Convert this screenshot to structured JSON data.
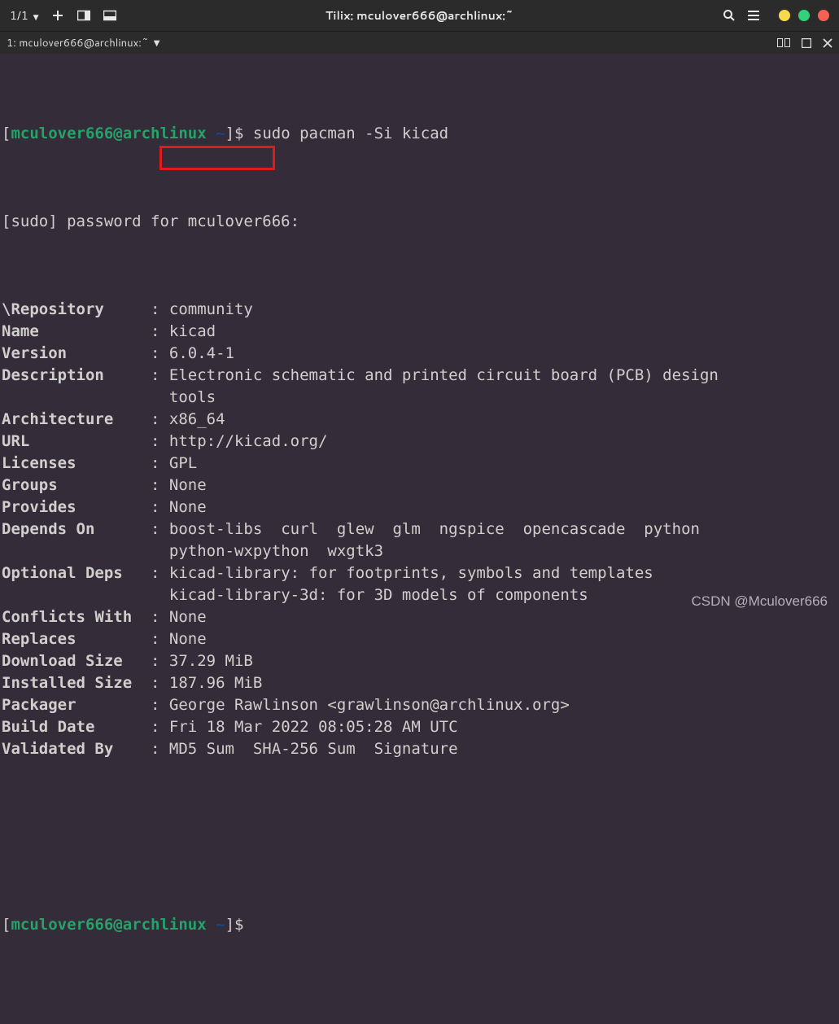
{
  "titlebar": {
    "pane_label": "1/1",
    "title": "Tilix: mculover666@archlinux:~"
  },
  "tabbar": {
    "tab_label": "1: mculover666@archlinux:~"
  },
  "traffic_colors": {
    "min": "#f7d94c",
    "max": "#33d17a",
    "close": "#f66151"
  },
  "prompt": {
    "open": "[",
    "user": "mculover666@archlinux",
    "space": " ",
    "tilde": "~",
    "close": "]$ ",
    "command": "sudo pacman -Si kicad"
  },
  "sudo_line": "[sudo] password for mculover666:",
  "fields": [
    {
      "label": "\\Repository     ",
      "value": "community"
    },
    {
      "label": "Name            ",
      "value": "kicad"
    },
    {
      "label": "Version         ",
      "value": "6.0.4-1"
    },
    {
      "label": "Description     ",
      "value": "Electronic schematic and printed circuit board (PCB) design"
    },
    {
      "label": "                ",
      "value": "tools",
      "cont": true
    },
    {
      "label": "Architecture    ",
      "value": "x86_64"
    },
    {
      "label": "URL             ",
      "value": "http://kicad.org/"
    },
    {
      "label": "Licenses        ",
      "value": "GPL"
    },
    {
      "label": "Groups          ",
      "value": "None"
    },
    {
      "label": "Provides        ",
      "value": "None"
    },
    {
      "label": "Depends On      ",
      "value": "boost-libs  curl  glew  glm  ngspice  opencascade  python"
    },
    {
      "label": "                ",
      "value": "python-wxpython  wxgtk3",
      "cont": true
    },
    {
      "label": "Optional Deps   ",
      "value": "kicad-library: for footprints, symbols and templates"
    },
    {
      "label": "                ",
      "value": "kicad-library-3d: for 3D models of components",
      "cont": true
    },
    {
      "label": "Conflicts With  ",
      "value": "None"
    },
    {
      "label": "Replaces        ",
      "value": "None"
    },
    {
      "label": "Download Size   ",
      "value": "37.29 MiB"
    },
    {
      "label": "Installed Size  ",
      "value": "187.96 MiB"
    },
    {
      "label": "Packager        ",
      "value": "George Rawlinson <grawlinson@archlinux.org>"
    },
    {
      "label": "Build Date      ",
      "value": "Fri 18 Mar 2022 08:05:28 AM UTC"
    },
    {
      "label": "Validated By    ",
      "value": "MD5 Sum  SHA-256 Sum  Signature"
    }
  ],
  "watermark": "CSDN @Mculover666"
}
